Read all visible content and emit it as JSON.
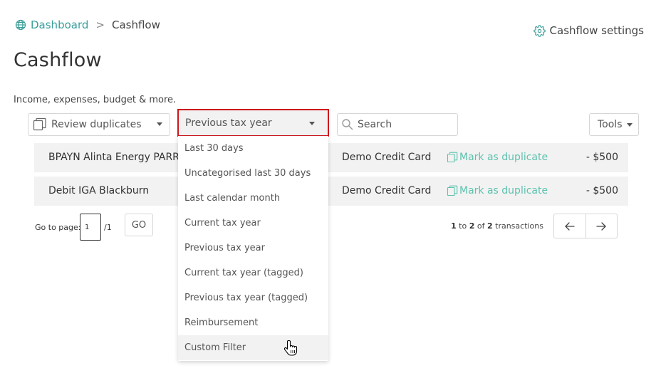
{
  "breadcrumb": {
    "home": "Dashboard",
    "separator": ">",
    "current": "Cashflow"
  },
  "header": {
    "settings_label": "Cashflow settings",
    "title": "Cashflow",
    "subtitle": "Income, expenses, budget & more."
  },
  "toolbar": {
    "review_label": "Review duplicates",
    "filter_selected": "Previous tax year",
    "search_placeholder": "Search",
    "tools_label": "Tools"
  },
  "transactions": [
    {
      "description": "BPAYN Alinta Energy PARRAMATTA",
      "account": "Demo Credit Card",
      "action": "Mark as duplicate",
      "amount": "- $500"
    },
    {
      "description": "Debit IGA Blackburn",
      "account": "Demo Credit Card",
      "action": "Mark as duplicate",
      "amount": "- $500"
    }
  ],
  "pagination": {
    "goto_label": "Go to page:",
    "page_value": "1",
    "page_total": "/1",
    "go_label": "GO",
    "range_start": "1",
    "range_to": "to",
    "range_end": "2",
    "range_of": "of",
    "total": "2",
    "noun": "transactions"
  },
  "filter_options": [
    "Last 30 days",
    "Uncategorised last 30 days",
    "Last calendar month",
    "Current tax year",
    "Previous tax year",
    "Current tax year (tagged)",
    "Previous tax year (tagged)",
    "Reimbursement",
    "Custom Filter"
  ],
  "colors": {
    "accent": "#3a9e9a",
    "action": "#5dc2ae",
    "highlight_border": "#d0141c",
    "row_bg": "#f2f2f2"
  },
  "icons": {
    "home": "globe-icon",
    "settings": "gear-icon",
    "review": "copy-icon",
    "search": "search-icon",
    "duplicate": "copy-icon",
    "prev": "arrow-left-icon",
    "next": "arrow-right-icon",
    "cursor": "hand-pointer-icon"
  }
}
